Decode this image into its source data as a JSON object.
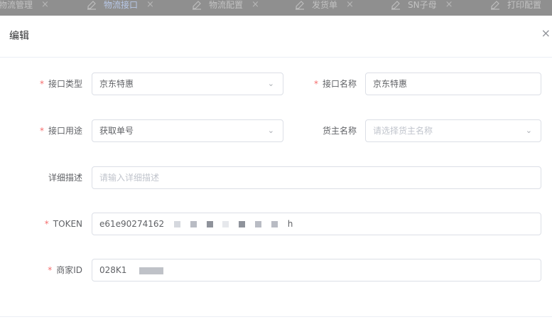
{
  "tabs": [
    {
      "label": "物流管理",
      "close": "×",
      "icon": "edit-icon"
    },
    {
      "label": "物流接口",
      "close": "×",
      "icon": "edit-icon",
      "active": true
    },
    {
      "label": "物流配置",
      "close": "×",
      "icon": "edit-icon"
    },
    {
      "label": "发货单",
      "close": "×",
      "icon": "edit-icon"
    },
    {
      "label": "SN子母",
      "close": "×",
      "icon": "edit-icon"
    },
    {
      "label": "打印配置",
      "icon": "edit-icon"
    }
  ],
  "dialog": {
    "title": "编辑",
    "close": "×"
  },
  "form": {
    "required_mark": "*",
    "interface_type": {
      "label": "接口类型",
      "value": "京东特惠"
    },
    "interface_name": {
      "label": "接口名称",
      "value": "京东特惠"
    },
    "interface_use": {
      "label": "接口用途",
      "value": "获取单号"
    },
    "owner_name": {
      "label": "货主名称",
      "placeholder": "请选择货主名称"
    },
    "description": {
      "label": "详细描述",
      "placeholder": "请输入详细描述"
    },
    "token": {
      "label": "TOKEN",
      "value_visible_start": "e61e90274162",
      "value_visible_end": "h"
    },
    "merchant_id": {
      "label": "商家ID",
      "value_visible": "028K1"
    }
  },
  "icons": {
    "select_arrow": "chevron-down-icon"
  },
  "colors": {
    "required": "#f56c6c",
    "border": "#dcdfe6",
    "placeholder": "#c0c4cc"
  }
}
